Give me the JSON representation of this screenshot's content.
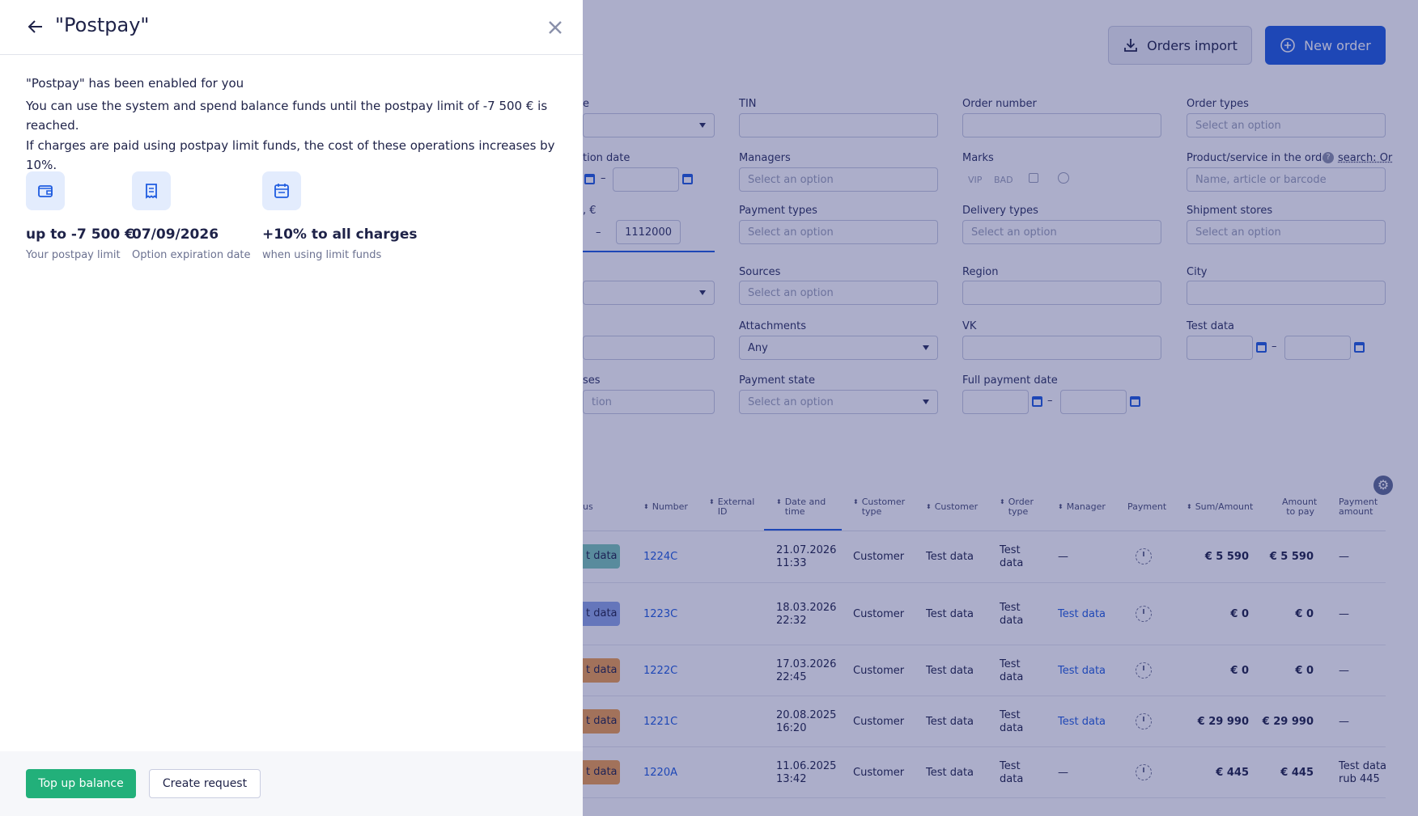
{
  "panel": {
    "title": "\"Postpay\"",
    "headline": "\"Postpay\" has been enabled for you",
    "description_line1": "You can use the system and spend balance funds until the postpay limit of -7 500 € is",
    "description_line2": "reached.",
    "description_line3": "If charges are paid using postpay limit funds, the cost of these operations increases by 10%.",
    "stats": [
      {
        "icon": "wallet-icon",
        "value": "up to -7 500 €",
        "caption": "Your postpay limit"
      },
      {
        "icon": "receipt-icon",
        "value": "07/09/2026",
        "caption": "Option expiration date"
      },
      {
        "icon": "calendar-icon",
        "value": "+10% to all charges",
        "caption": "when using limit funds"
      }
    ],
    "buttons": {
      "top_up": "Top up balance",
      "create_request": "Create request"
    },
    "colors": {
      "accent_green": "#22b07a",
      "tile_bg": "#e3ecfd",
      "icon_blue": "#1f5ce0"
    }
  },
  "header": {
    "orders_import": "Orders import",
    "new_order": "New order"
  },
  "filters": {
    "tin_label": "TIN",
    "order_number_label": "Order number",
    "order_types_label": "Order types",
    "order_types_placeholder": "Select an option",
    "creation_date_label_partial": "tion date",
    "managers_label": "Managers",
    "managers_placeholder": "Select an option",
    "marks_label": "Marks",
    "marks": [
      "VIP",
      "BAD"
    ],
    "product_label": "Product/service in the order",
    "product_search": "search: Or",
    "product_placeholder": "Name, article or barcode",
    "amount_label_partial": ", €",
    "amount_to": "1112000",
    "payment_types_label": "Payment types",
    "payment_types_placeholder": "Select an option",
    "delivery_types_label": "Delivery types",
    "delivery_types_placeholder": "Select an option",
    "shipment_stores_label": "Shipment stores",
    "shipment_stores_placeholder": "Select an option",
    "sources_label": "Sources",
    "sources_placeholder": "Select an option",
    "region_label": "Region",
    "city_label": "City",
    "attachments_label": "Attachments",
    "attachments_value": "Any",
    "vk_label": "VK",
    "test_data_label": "Test data",
    "statuses_label_partial": "ses",
    "statuses_placeholder_partial": "tion",
    "payment_state_label": "Payment state",
    "payment_state_placeholder": "Select an option",
    "full_payment_date_label": "Full payment date",
    "dash": "–"
  },
  "table": {
    "headers": {
      "status_partial": "us",
      "number": "Number",
      "external_id": [
        "External",
        "ID"
      ],
      "date_time": [
        "Date and",
        "time"
      ],
      "customer_type": [
        "Customer",
        "type"
      ],
      "customer": "Customer",
      "order_type": [
        "Order",
        "type"
      ],
      "manager": "Manager",
      "payment": "Payment",
      "sum_amount": "Sum/Amount",
      "amount_to_pay": [
        "Amount",
        "to pay"
      ],
      "payment_amount": [
        "Payment",
        "amount"
      ]
    },
    "rows": [
      {
        "status": "t data",
        "status_color": "#7cc8b8",
        "number": "1224C",
        "date": "21.07.2026",
        "time": "11:33",
        "customer_type": "Customer",
        "customer": "Test data",
        "order_type": [
          "Test",
          "data"
        ],
        "manager": "—",
        "manager_link": false,
        "sum": "€ 5 590",
        "to_pay": "€ 5 590",
        "payment_amount": [
          "—"
        ]
      },
      {
        "status": "t data",
        "status_color": "#8fa6e8",
        "number": "1223C",
        "date": "18.03.2026",
        "time": "22:32",
        "customer_type": "Customer",
        "customer": "Test data",
        "order_type": [
          "Test",
          "data"
        ],
        "manager": "Test data",
        "manager_link": true,
        "sum": "€ 0",
        "to_pay": "€ 0",
        "payment_amount": [
          "—"
        ]
      },
      {
        "status": "t data",
        "status_color": "#f0a050",
        "number": "1222C",
        "date": "17.03.2026",
        "time": "22:45",
        "customer_type": "Customer",
        "customer": "Test data",
        "order_type": [
          "Test",
          "data"
        ],
        "manager": "Test data",
        "manager_link": true,
        "sum": "€ 0",
        "to_pay": "€ 0",
        "payment_amount": [
          "—"
        ]
      },
      {
        "status": "t data",
        "status_color": "#f0a050",
        "number": "1221C",
        "date": "20.08.2025",
        "time": "16:20",
        "customer_type": "Customer",
        "customer": "Test data",
        "order_type": [
          "Test",
          "data"
        ],
        "manager": "Test data",
        "manager_link": true,
        "sum": "€ 29 990",
        "to_pay": "€ 29 990",
        "payment_amount": [
          "—"
        ]
      },
      {
        "status": "t data",
        "status_color": "#f0a050",
        "number": "1220A",
        "date": "11.06.2025",
        "time": "13:42",
        "customer_type": "Customer",
        "customer": "Test data",
        "order_type": [
          "Test",
          "data"
        ],
        "manager": "—",
        "manager_link": false,
        "sum": "€ 445",
        "to_pay": "€ 445",
        "payment_amount": [
          "Test data",
          "rub 445"
        ]
      }
    ]
  }
}
